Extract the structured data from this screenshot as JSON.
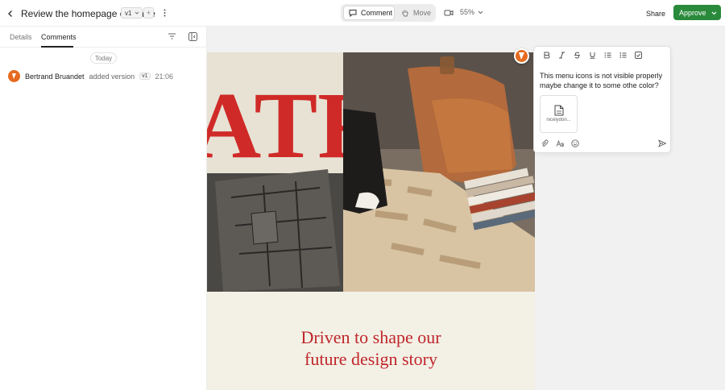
{
  "header": {
    "title": "Review the homepage of Matre",
    "version": "v1",
    "add_version": "+",
    "modes": {
      "comment": "Comment",
      "move": "Move"
    },
    "zoom": "55%",
    "share": "Share",
    "approve": "Approve"
  },
  "sidebar": {
    "tabs": [
      "Details",
      "Comments"
    ],
    "active_tab": "Comments",
    "date_separator": "Today",
    "activity": {
      "user": "Bertrand Bruandet",
      "action": "added version",
      "version": "v1",
      "time": "21:06"
    }
  },
  "canvas": {
    "headline_line1": "Driven to shape our",
    "headline_line2": "future design story",
    "photo_text": "ATRE"
  },
  "comment_box": {
    "toolbar": [
      "bold-icon",
      "italic-icon",
      "strikethrough-icon",
      "underline-icon",
      "ordered-list-icon",
      "bullet-list-icon",
      "checklist-icon"
    ],
    "text": "This menu icons is not visible properly maybe change it to some othe color?",
    "attachment_name": "nicelydon..."
  },
  "colors": {
    "approve": "#2a8a3b",
    "avatar": "#e56a1f",
    "headline": "#c0262b"
  }
}
